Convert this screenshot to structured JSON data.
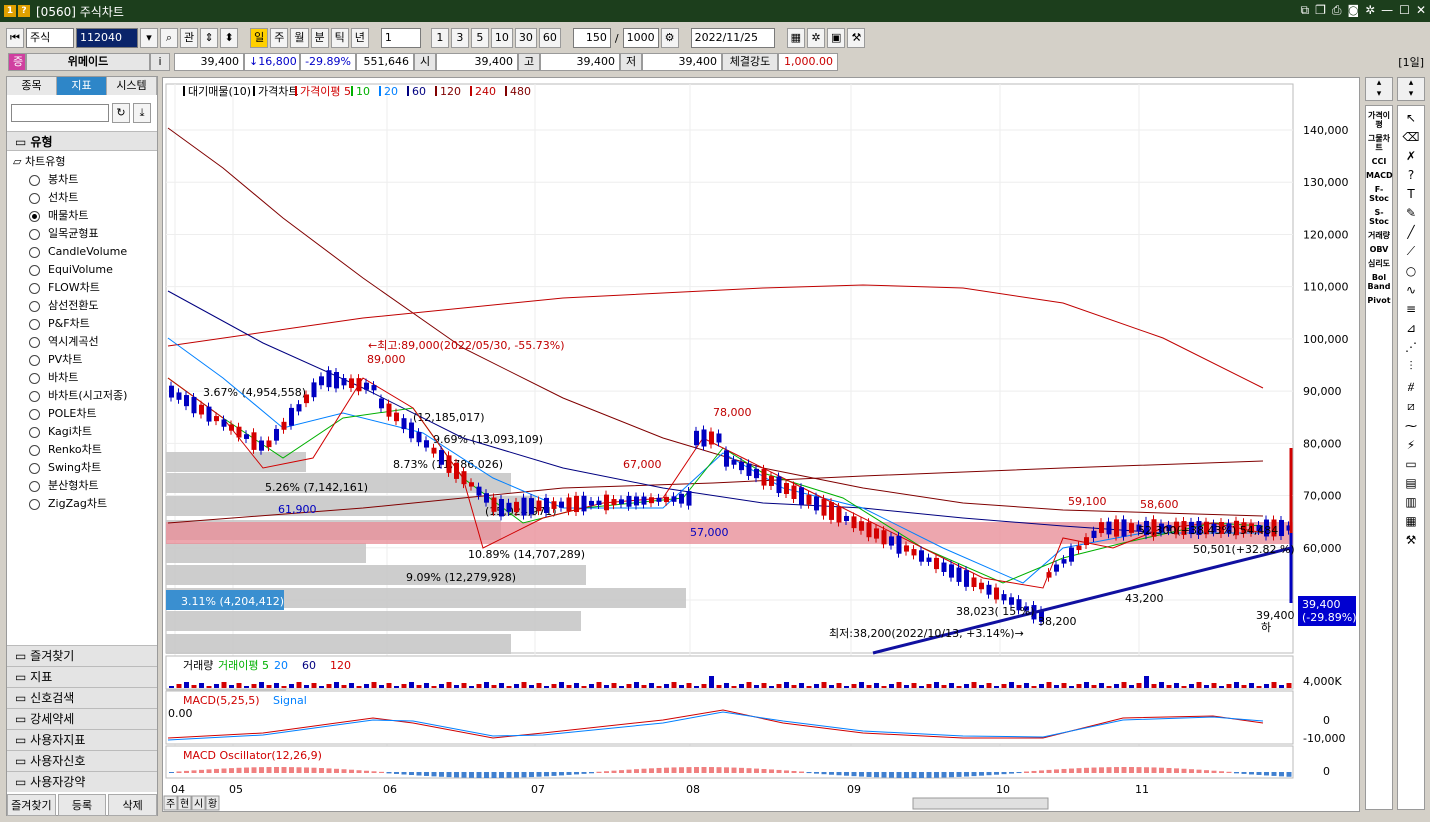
{
  "window": {
    "title": "[0560] 주식차트",
    "icon1": "1",
    "icon2": "?"
  },
  "toolbar": {
    "market_type": "주식",
    "code": "112040",
    "btn_gwan": "관",
    "periods": [
      "일",
      "주",
      "월",
      "분",
      "틱",
      "년"
    ],
    "active_period": "일",
    "unit_select": "1",
    "intervals": [
      "1",
      "3",
      "5",
      "10",
      "30",
      "60"
    ],
    "count": "150",
    "slash": "/",
    "max_count": "1000",
    "date": "2022/11/25"
  },
  "quote": {
    "badge": "증",
    "name": "위메이드",
    "info_icon": "i",
    "price": "39,400",
    "change": "↓16,800",
    "rate": "-29.89%",
    "volume": "551,646",
    "open_label": "시",
    "open": "39,400",
    "high_label": "고",
    "high": "39,400",
    "low_label": "저",
    "low": "39,400",
    "strength_label": "체결강도",
    "strength": "1,000.00",
    "period_tag": "[1일]"
  },
  "left_panel": {
    "tabs": [
      "종목",
      "지표",
      "시스템"
    ],
    "active_tab": "지표",
    "section_title": "유형",
    "group_title": "차트유형",
    "chart_types": [
      "봉차트",
      "선차트",
      "매물차트",
      "일목균형표",
      "CandleVolume",
      "EquiVolume",
      "FLOW차트",
      "삼선전환도",
      "P&F차트",
      "역시계곡선",
      "PV차트",
      "바차트",
      "바차트(시고저종)",
      "POLE차트",
      "Kagi차트",
      "Renko차트",
      "Swing차트",
      "분산형차트",
      "ZigZag차트"
    ],
    "selected_type": "매물차트",
    "bottom_sections": [
      "즐겨찾기",
      "지표",
      "신호검색",
      "강세약세",
      "사용자지표",
      "사용자신호",
      "사용자강약"
    ],
    "footer": [
      "즐겨찾기",
      "등록",
      "삭제"
    ]
  },
  "price_chart": {
    "legend": [
      "대기매물(10)",
      "가격차트",
      "가격이평 5",
      "10",
      "20",
      "60",
      "120",
      "240",
      "480"
    ],
    "y_ticks": [
      "140,000",
      "130,000",
      "120,000",
      "110,000",
      "100,000",
      "90,000",
      "80,000",
      "70,000",
      "60,000",
      "50,000"
    ],
    "x_ticks": [
      "04",
      "05",
      "06",
      "07",
      "08",
      "09",
      "10",
      "11"
    ],
    "volume_profile": [
      "3.67% (4,954,558)",
      "(12,185,017)",
      "9.69% (13,093,109)",
      "8.73% (11,786,026)",
      "5.26% (7,142,161)",
      "(15,024,971)",
      "10.89% (14,707,289)",
      "9.09% (12,279,928)",
      "3.11% (4,204,412)"
    ],
    "annotations": {
      "high": "←최고:89,000(2022/05/30, -55.73%)",
      "p89000": "89,000",
      "p78000": "78,000",
      "p67000": "67,000",
      "p61900": "61,900",
      "p59100": "59,100",
      "p58600": "58,600",
      "p57000": "57,000",
      "p43200": "43,200",
      "p38200": "38,200",
      "low": "최저:38,200(2022/10/13, +3.14%)→",
      "trend1": "38,023( 15 %)",
      "trend2": "50,501(+32.82 %)",
      "near": "52,300(+38.43%) 54,484",
      "last_marker": "39,400",
      "last_marker_label": "하",
      "current": "39,400",
      "current_rate": "(-29.89%)"
    }
  },
  "volume_chart": {
    "legend": [
      "거래량",
      "거래이평 5",
      "20",
      "60",
      "120"
    ],
    "y_tick": "4,000K"
  },
  "macd_chart": {
    "legend": [
      "MACD(5,25,5)",
      "Signal"
    ],
    "value": "0.00",
    "y_ticks": [
      "0",
      "-10,000"
    ]
  },
  "osc_chart": {
    "legend": [
      "MACD Oscillator(12,26,9)"
    ],
    "y_tick": "0"
  },
  "bottom_bar": {
    "tabs": [
      "주",
      "현",
      "시",
      "황"
    ]
  },
  "right_panel": {
    "labels": [
      "가격이평",
      "그물차트",
      "CCI",
      "MACD",
      "F-Stoc",
      "S-Stoc",
      "거래량",
      "OBV",
      "심리도",
      "Bol Band",
      "Pivot"
    ]
  },
  "colors": {
    "candle_up": "#d40000",
    "candle_down": "#0000c0",
    "profile_bar": "#c8c8c8",
    "profile_hi": "#e8909a",
    "ma5": "#d00000",
    "ma10": "#00b000",
    "ma20": "#0080ff",
    "ma60": "#000080",
    "ma120": "#800000",
    "ma240": "#c00000"
  }
}
